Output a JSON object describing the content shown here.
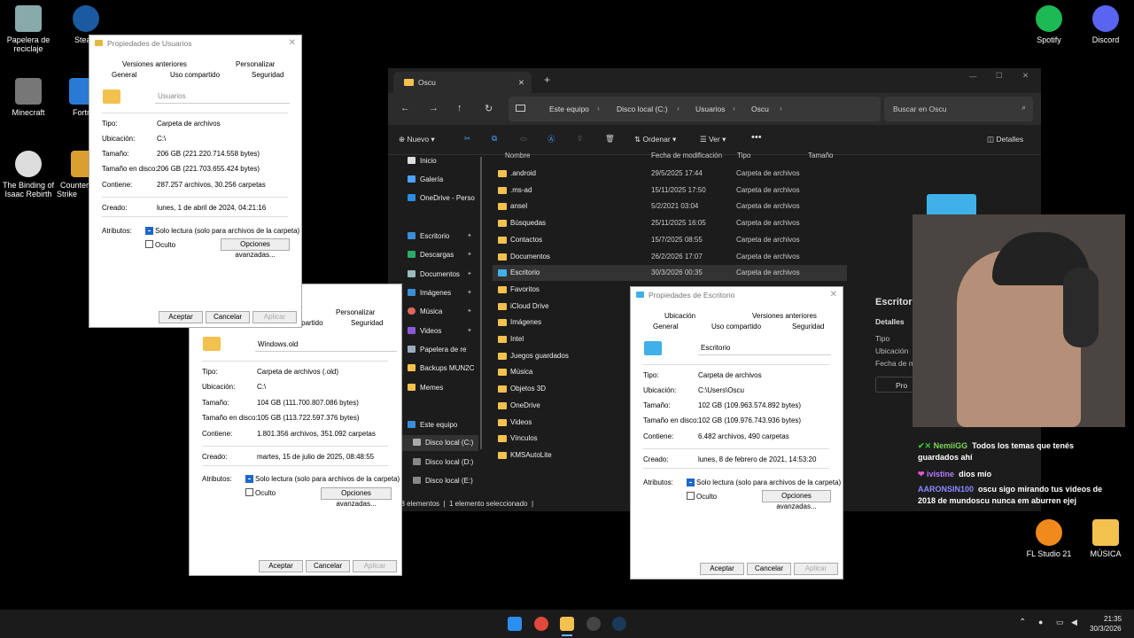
{
  "desktop": {
    "icons": [
      {
        "label": "Papelera de reciclaje"
      },
      {
        "label": "Steam"
      },
      {
        "label": "Minecraft"
      },
      {
        "label": "Fortnite"
      },
      {
        "label": "The Binding of Isaac Rebirth"
      },
      {
        "label": "Counter-Strike"
      },
      {
        "label": "Spotify"
      },
      {
        "label": "Discord"
      },
      {
        "label": "FL Studio 21"
      },
      {
        "label": "MÚSICA"
      }
    ]
  },
  "dlg1": {
    "title": "Propiedades de Usuarios",
    "tab_prev": "Versiones anteriores",
    "tab_custom": "Personalizar",
    "tab_general": "General",
    "tab_shared": "Uso compartido",
    "tab_security": "Seguridad",
    "name": "Usuarios",
    "rows": [
      [
        "Tipo:",
        "Carpeta de archivos"
      ],
      [
        "Ubicación:",
        "C:\\"
      ],
      [
        "Tamaño:",
        "206 GB (221.220.714.558 bytes)"
      ],
      [
        "Tamaño en disco:",
        "206 GB (221.703.655.424 bytes)"
      ],
      [
        "Contiene:",
        "287.257 archivos, 30.256 carpetas"
      ],
      [
        "Creado:",
        "lunes, 1 de abril de 2024, 04:21:16"
      ]
    ],
    "attr": "Atributos:",
    "readonly": "Solo lectura (solo para archivos de la carpeta)",
    "hidden": "Oculto",
    "advanced": "Opciones avanzadas...",
    "ok": "Aceptar",
    "cancel": "Cancelar",
    "apply": "Aplicar"
  },
  "dlg2": {
    "tab_custom": "Personalizar",
    "tab_shared": "ompartido",
    "tab_security": "Seguridad",
    "name": "Windows.old",
    "rows": [
      [
        "Tipo:",
        "Carpeta de archivos (.old)"
      ],
      [
        "Ubicación:",
        "C:\\"
      ],
      [
        "Tamaño:",
        "104 GB (111.700.807.086 bytes)"
      ],
      [
        "Tamaño en disco:",
        "105 GB (113.722.597.376 bytes)"
      ],
      [
        "Contiene:",
        "1.801.356 archivos, 351.092 carpetas"
      ],
      [
        "Creado:",
        "martes, 15 de julio de 2025, 08:48:55"
      ]
    ],
    "attr": "Atributos:",
    "readonly": "Solo lectura (solo para archivos de la carpeta)",
    "hidden": "Oculto",
    "advanced": "Opciones avanzadas...",
    "ok": "Aceptar",
    "cancel": "Cancelar",
    "apply": "Aplicar"
  },
  "dlg3": {
    "title": "Propiedades de Escritorio",
    "tab_loc": "Ubicación",
    "tab_prev": "Versiones anteriores",
    "tab_general": "General",
    "tab_shared": "Uso compartido",
    "tab_security": "Seguridad",
    "name": "Escritorio",
    "rows": [
      [
        "Tipo:",
        "Carpeta de archivos"
      ],
      [
        "Ubicación:",
        "C:\\Users\\Oscu"
      ],
      [
        "Tamaño:",
        "102 GB (109.963.574.892 bytes)"
      ],
      [
        "Tamaño en disco:",
        "102 GB (109.976.743.936 bytes)"
      ],
      [
        "Contiene:",
        "6.482 archivos, 490 carpetas"
      ],
      [
        "Creado:",
        "lunes, 8 de febrero de 2021, 14:53:20"
      ]
    ],
    "attr": "Atributos:",
    "readonly": "Solo lectura (solo para archivos de la carpeta)",
    "hidden": "Oculto",
    "advanced": "Opciones avanzadas...",
    "ok": "Aceptar",
    "cancel": "Cancelar",
    "apply": "Aplicar"
  },
  "explorer": {
    "tab": "Oscu",
    "crumbs": [
      "Este equipo",
      "Disco local (C:)",
      "Usuarios",
      "Oscu"
    ],
    "search": "Buscar en Oscu",
    "new": "Nuevo",
    "order": "Ordenar",
    "view": "Ver",
    "details": "Detalles",
    "cols": [
      "Nombre",
      "Fecha de modificación",
      "Tipo",
      "Tamaño"
    ],
    "files": [
      [
        ".android",
        "29/5/2025 17:44",
        "Carpeta de archivos"
      ],
      [
        ".ms-ad",
        "15/11/2025 17:50",
        "Carpeta de archivos"
      ],
      [
        "ansel",
        "5/2/2021 03:04",
        "Carpeta de archivos"
      ],
      [
        "Búsquedas",
        "25/11/2025 16:05",
        "Carpeta de archivos"
      ],
      [
        "Contactos",
        "15/7/2025 08:55",
        "Carpeta de archivos"
      ],
      [
        "Documentos",
        "26/2/2026 17:07",
        "Carpeta de archivos"
      ],
      [
        "Escritorio",
        "30/3/2026 00:35",
        "Carpeta de archivos"
      ],
      [
        "Favoritos",
        "",
        ""
      ],
      [
        "iCloud Drive",
        "",
        ""
      ],
      [
        "Imágenes",
        "",
        ""
      ],
      [
        "Intel",
        "",
        ""
      ],
      [
        "Juegos guardados",
        "",
        ""
      ],
      [
        "Música",
        "",
        ""
      ],
      [
        "Objetos 3D",
        "",
        ""
      ],
      [
        "OneDrive",
        "",
        ""
      ],
      [
        "Videos",
        "",
        ""
      ],
      [
        "Vínculos",
        "",
        ""
      ],
      [
        "KMSAutoLite",
        "",
        ""
      ]
    ],
    "side": [
      "Inicio",
      "Galería",
      "OneDrive - Perso",
      "Escritorio",
      "Descargas",
      "Documentos",
      "Imágenes",
      "Música",
      "Videos",
      "Papelera de re",
      "Backups MUN2C",
      "Memes",
      "Este equipo",
      "Disco local (C:)",
      "Disco local (D:)",
      "Disco local (E:)"
    ],
    "status": "18 elementos",
    "status2": "1 elemento seleccionado",
    "detail_title": "Escritori",
    "detail_tab": "Detalles",
    "detail_rows": [
      "Tipo",
      "Ubicación",
      "Fecha de m"
    ],
    "detail_btn": "Pro"
  },
  "chat": [
    {
      "user": "NemiiGG",
      "msg": "Todos los temas que tenés guardados ahí"
    },
    {
      "user": "ivistine",
      "msg": "dios mío"
    },
    {
      "user": "AARONSIN100",
      "msg": "oscu sigo mirando tus videos de 2018 de mundoscu nunca em aburren ejej"
    }
  ],
  "clock": {
    "time": "21:35",
    "date": "30/3/2026"
  }
}
